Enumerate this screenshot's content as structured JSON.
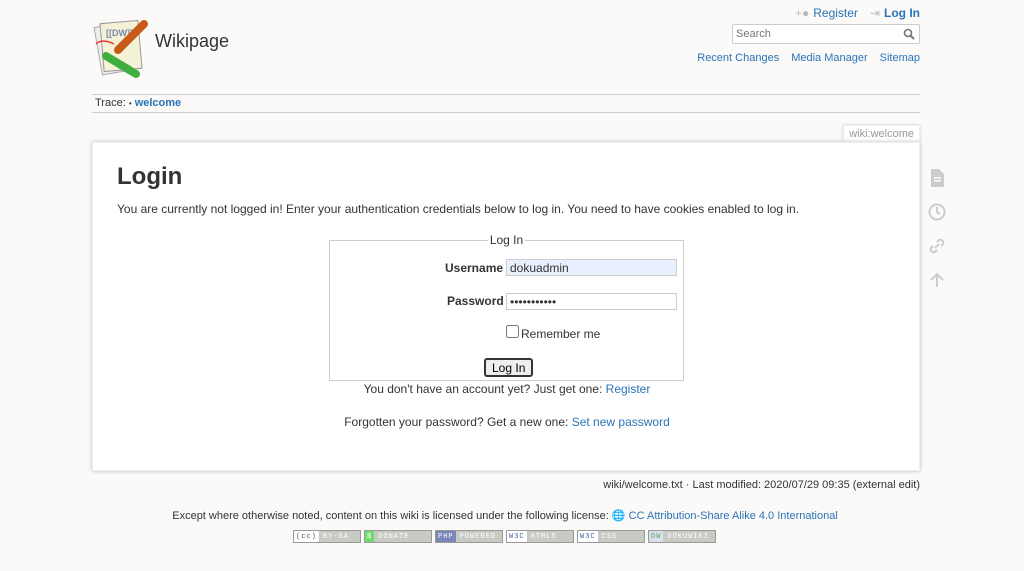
{
  "site": {
    "title": "Wikipage",
    "logo_text": "[[DW]]"
  },
  "usertools": {
    "register": "Register",
    "login": "Log In"
  },
  "search": {
    "placeholder": "Search"
  },
  "sitetools": [
    "Recent Changes",
    "Media Manager",
    "Sitemap"
  ],
  "trace": {
    "label": "Trace:",
    "sep": "•",
    "crumb": "welcome"
  },
  "pageid": "wiki:welcome",
  "main": {
    "heading": "Login",
    "intro": "You are currently not logged in! Enter your authentication credentials below to log in. You need to have cookies enabled to log in.",
    "form": {
      "legend": "Log In",
      "username_label": "Username",
      "username_value": "dokuadmin",
      "password_label": "Password",
      "password_value": "xxxxxxxxxxx",
      "remember_label": "Remember me",
      "remember_checked": false,
      "submit": "Log In"
    },
    "register_text": "You don't have an account yet? Just get one:",
    "register_link": "Register",
    "forgot_text": "Forgotten your password? Get a new one:",
    "forgot_link": "Set new password"
  },
  "pagetools": [
    "show-page-icon",
    "old-revisions-icon",
    "backlinks-icon",
    "back-to-top-icon"
  ],
  "docinfo": "wiki/welcome.txt · Last modified: 2020/07/29 09:35 (external edit)",
  "license": {
    "text": "Except where otherwise noted, content on this wiki is licensed under the following license:",
    "link": "CC Attribution-Share Alike 4.0 International"
  },
  "badges": [
    {
      "l": "(cc)",
      "r": "BY-SA"
    },
    {
      "l": "$",
      "r": "DONATE"
    },
    {
      "l": "PHP",
      "r": "POWERED"
    },
    {
      "l": "W3C",
      "r": "HTML5"
    },
    {
      "l": "W3C",
      "r": "CSS"
    },
    {
      "l": "DW",
      "r": "DOKUWIKI"
    }
  ],
  "colors": {
    "link": "#2b73b7",
    "background": "#fbfaf9",
    "username_bg": "#e8f0fe"
  }
}
